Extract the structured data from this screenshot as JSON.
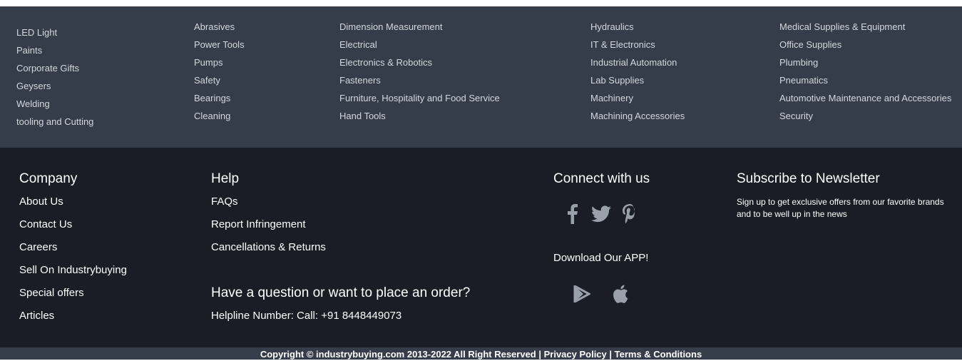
{
  "categories": {
    "col1": [
      "LED Light",
      "Paints",
      "Corporate Gifts",
      "Geysers",
      "Welding",
      "tooling and Cutting"
    ],
    "col2": [
      "Abrasives",
      "Power Tools",
      "Pumps",
      "Safety",
      "Bearings",
      "Cleaning"
    ],
    "col3": [
      "Dimension Measurement",
      "Electrical",
      "Electronics & Robotics",
      "Fasteners",
      "Furniture, Hospitality and Food Service",
      "Hand Tools"
    ],
    "col4": [
      "Hydraulics",
      "IT & Electronics",
      "Industrial Automation",
      "Lab Supplies",
      "Machinery",
      "Machining Accessories"
    ],
    "col5": [
      "Medical Supplies & Equipment",
      "Office Supplies",
      "Plumbing",
      "Pneumatics",
      "Automotive Maintenance and Accessories",
      "Security"
    ]
  },
  "company": {
    "title": "Company",
    "links": [
      "About Us",
      "Contact Us",
      "Careers",
      "Sell On Industrybuying",
      "Special offers",
      "Articles"
    ]
  },
  "help": {
    "title": "Help",
    "links": [
      "FAQs",
      "Report Infringement",
      "Cancellations & Returns"
    ],
    "question_title": "Have a question or want to place an order?",
    "helpline": "Helpline Number: Call: +91 8448449073"
  },
  "connect": {
    "title": "Connect with us",
    "social_icons": [
      "facebook-icon",
      "twitter-icon",
      "pinterest-icon"
    ],
    "download_label": "Download Our APP!",
    "app_icons": [
      "google-play-icon",
      "apple-icon"
    ]
  },
  "newsletter": {
    "title": "Subscribe to Newsletter",
    "text": "Sign up to get exclusive offers from our favorite brands and to be well up in the news"
  },
  "copyright": {
    "text": "Copyright © industrybuying.com 2013-2022 All Right Reserved | Privacy Policy | Terms & Conditions"
  },
  "colors": {
    "category_bg": "#353d4a",
    "footer_bg": "#1a1d25",
    "icon_gray": "#9aa0aa"
  }
}
